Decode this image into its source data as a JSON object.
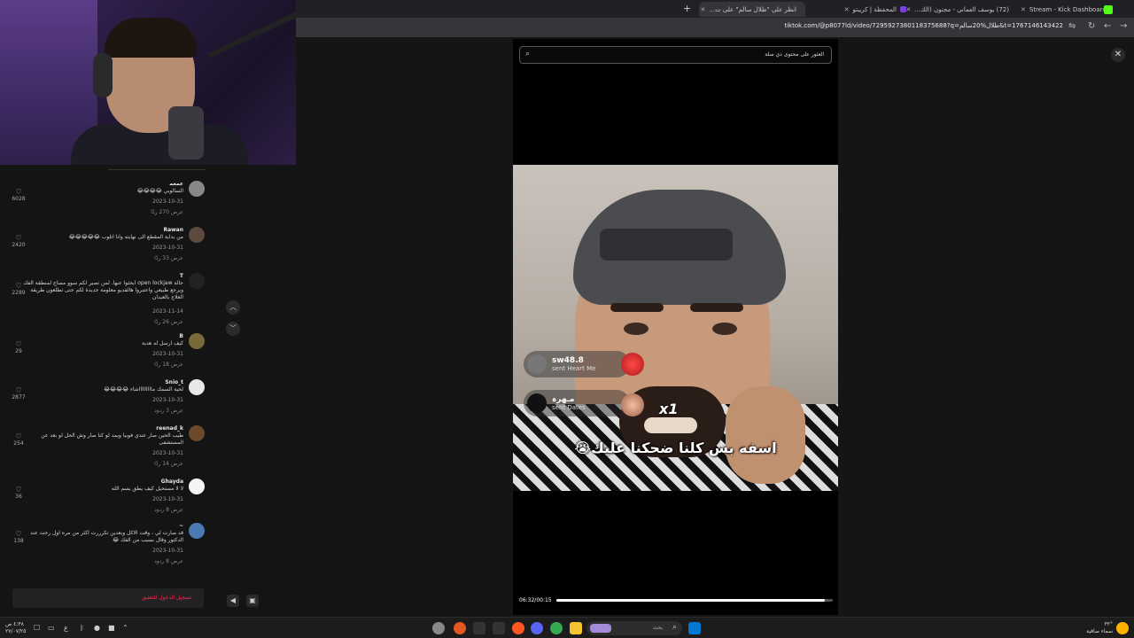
{
  "browser": {
    "tabs": [
      {
        "label": "انظر على \"طلال سالم\" على ت...",
        "active": true,
        "fav": "#25f4ee"
      },
      {
        "label": "المحفظة | كريبتو",
        "active": false,
        "fav": "#7b3fe4"
      },
      {
        "label": "(72) يوسف العماني - مجنون (الك...",
        "active": false,
        "fav": "#ff0000"
      },
      {
        "label": "Stream - Kick Dashboard",
        "active": false,
        "fav": "#53fc18"
      }
    ],
    "url": "tiktok.com/@p8077ld/video/7295927380118375688?q=طلال%20سالم&t=1767146143422"
  },
  "search": {
    "placeholder": "العثور على محتوى ذي صلة"
  },
  "comments": [
    {
      "user": "ﻋﻤﻌﻤ",
      "text": "السالوبي 😂😂😂😂",
      "date": "2023-10-31",
      "replies": "عرض 270 ردًا",
      "likes": "6028",
      "avatar": "#888"
    },
    {
      "user": "Rawan",
      "text": "من بداية المقطع الى نهايته وانا اتلوب 😂😂😂😂😂",
      "date": "2023-10-31",
      "replies": "عرض 33 ردًا",
      "likes": "2420",
      "avatar": "#5c4a3e"
    },
    {
      "user": "T",
      "text": "حالة open lockjaw ابحثوا عنها. لمن تصير لكم سوو مساج لمنطقة الفك ويرجع طبيعي واعتبروا هالفديو معلومة جديدة لكم حتى تطلعون طريقة العلاج بالعيدان",
      "date": "2023-11-14",
      "replies": "عرض 26 ردًا",
      "likes": "2289",
      "avatar": "#222"
    },
    {
      "user": "B",
      "text": "كيف ارسل له هدية",
      "date": "2023-10-31",
      "replies": "عرض 18 ردًا",
      "likes": "29",
      "avatar": "#7a6a3a"
    },
    {
      "user": "Snio_t",
      "text": "لحية السمك ماااااااااشاء 😂😂😂😂",
      "date": "2023-10-31",
      "replies": "عرض 3 ردود",
      "likes": "2877",
      "avatar": "#e8e8e8"
    },
    {
      "user": "reenad_k",
      "text": "طيب الحين صار عندي فوبيا ويمد لو كنا صار وش الحل لو بعد عن المستشفى",
      "date": "2023-10-31",
      "replies": "عرض 14 ردًا",
      "likes": "254",
      "avatar": "#6b4a2a"
    },
    {
      "user": "Ghayda",
      "text": "لا لا مستحيل كيف يطق يسم الله",
      "date": "2023-10-31",
      "replies": "عرض 8 ردود",
      "likes": "36",
      "avatar": "#f4f4f4"
    },
    {
      "user": "~",
      "text": "قد صارت لي ، وقت الاكل وبعدين تكرررت اكثر من مره اول رحت عند الدكتور وقال بسبب من الفك 😂",
      "date": "2023-10-31",
      "replies": "عرض 8 ردود",
      "likes": "138",
      "avatar": "#4a7ab0"
    }
  ],
  "login": {
    "label": "تسجيل الدخول للتعليق"
  },
  "video": {
    "gift1": {
      "name": "sw48.8",
      "sub": "sent Heart Me"
    },
    "gift2": {
      "name": "مـهرہ",
      "sub": "sent Dates",
      "mult": "x1"
    },
    "caption": "اسفه بس كلنا ضحكنا عليك😭",
    "time": "06:32/00:15",
    "progress": 0.97
  },
  "taskbar": {
    "search_placeholder": "بحث",
    "clock_time": "٤:٣٨ ص",
    "clock_date": "٢٧/٠٧/٢٥",
    "weather_temp": "°٣٢",
    "weather_desc": "سماء صافية",
    "lang": "ع"
  }
}
